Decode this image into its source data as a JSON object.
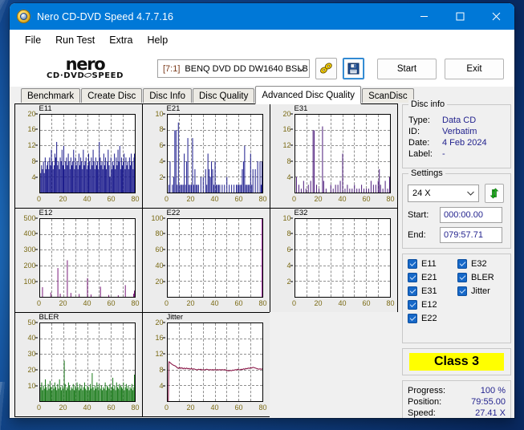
{
  "window": {
    "title": "Nero CD-DVD Speed 4.7.7.16",
    "app_icon": "nero-disc-icon",
    "minimize": "minimize-icon",
    "maximize": "maximize-icon",
    "close": "close-icon"
  },
  "menu": [
    "File",
    "Run Test",
    "Extra",
    "Help"
  ],
  "logo": {
    "word": "nero",
    "sub_left": "CD·DVD",
    "sub_right": "SPEED"
  },
  "toolbar": {
    "drive_index": "[7:1]",
    "drive_name": "BENQ DVD DD DW1640 BSLB",
    "caret": "▼",
    "eject_icon": "disc-speed-icon",
    "save_icon": "floppy-save-icon",
    "start_label": "Start",
    "exit_label": "Exit"
  },
  "tabs": [
    {
      "label": "Benchmark",
      "active": false
    },
    {
      "label": "Create Disc",
      "active": false
    },
    {
      "label": "Disc Info",
      "active": false
    },
    {
      "label": "Disc Quality",
      "active": false
    },
    {
      "label": "Advanced Disc Quality",
      "active": true
    },
    {
      "label": "ScanDisc",
      "active": false
    }
  ],
  "disc_info": {
    "title": "Disc info",
    "rows": [
      {
        "key": "Type:",
        "value": "Data CD"
      },
      {
        "key": "ID:",
        "value": "Verbatim"
      },
      {
        "key": "Date:",
        "value": "4 Feb 2024"
      },
      {
        "key": "Label:",
        "value": "-"
      }
    ]
  },
  "settings": {
    "title": "Settings",
    "speed": "24 X",
    "caret": "▼",
    "refresh_icon": "refresh-green-arrows-icon",
    "start_label": "Start:",
    "start_value": "000:00.00",
    "end_label": "End:",
    "end_value": "079:57.71"
  },
  "checkboxes": [
    {
      "label": "E11",
      "checked": true
    },
    {
      "label": "E32",
      "checked": true
    },
    {
      "label": "E21",
      "checked": true
    },
    {
      "label": "BLER",
      "checked": true
    },
    {
      "label": "E31",
      "checked": true
    },
    {
      "label": "Jitter",
      "checked": true
    },
    {
      "label": "E12",
      "checked": true
    },
    {
      "label": "",
      "checked": false
    },
    {
      "label": "E22",
      "checked": true
    },
    {
      "label": "",
      "checked": false
    }
  ],
  "quality": {
    "class_label": "Class 3",
    "highlight_color": "#ffff00"
  },
  "status": {
    "rows": [
      {
        "key": "Progress:",
        "value": "100 %"
      },
      {
        "key": "Position:",
        "value": "79:55.00"
      },
      {
        "key": "Speed:",
        "value": "27.41 X"
      }
    ]
  },
  "chart_data": [
    {
      "type": "bar",
      "title": "E11",
      "xlabel": "",
      "ylabel": "",
      "xlim": [
        0,
        80
      ],
      "ylim": [
        0,
        20
      ],
      "xticks": [
        0,
        20,
        40,
        60,
        80
      ],
      "yticks": [
        4,
        8,
        12,
        16,
        20
      ],
      "grid": true,
      "color": "#1a1a8c",
      "x": [
        0.5,
        1.2,
        2,
        2.8,
        3.5,
        4.3,
        5,
        5.8,
        6.5,
        7.3,
        8,
        8.8,
        9.5,
        10.3,
        11,
        11.8,
        12.5,
        13.3,
        14,
        14.8,
        15.5,
        16.3,
        17,
        17.8,
        18.5,
        19.3,
        20,
        20.8,
        21.5,
        22.3,
        23,
        23.8,
        24.5,
        25.3,
        26,
        26.8,
        27.5,
        28.3,
        29,
        29.8,
        30.5,
        31.3,
        32,
        32.8,
        33.5,
        34.3,
        35,
        35.8,
        36.5,
        37.3,
        38,
        38.8,
        39.5,
        40.3,
        41,
        41.8,
        42.5,
        43.3,
        44,
        44.8,
        45.5,
        46.3,
        47,
        47.8,
        48.5,
        49.3,
        50,
        50.8,
        51.5,
        52.3,
        53,
        53.8,
        54.5,
        55.3,
        56,
        56.8,
        57.5,
        58.3,
        59,
        59.8,
        60.5,
        61.3,
        62,
        62.8,
        63.5,
        64.3,
        65,
        65.8,
        66.5,
        67.3,
        68,
        68.8,
        69.5,
        70.3,
        71,
        71.8,
        72.5,
        73.3,
        74,
        74.8,
        75.5,
        76.3,
        77,
        77.8,
        78.5,
        79.3,
        80
      ],
      "values": [
        5,
        7,
        6,
        8,
        5,
        9,
        6,
        7,
        8,
        6,
        9,
        7,
        11,
        8,
        6,
        7,
        10,
        9,
        13,
        7,
        8,
        6,
        9,
        8,
        11,
        7,
        12,
        6,
        8,
        9,
        7,
        10,
        8,
        6,
        9,
        7,
        8,
        11,
        6,
        9,
        7,
        8,
        6,
        10,
        7,
        9,
        8,
        6,
        11,
        7,
        8,
        9,
        6,
        7,
        10,
        8,
        6,
        9,
        7,
        11,
        8,
        6,
        9,
        7,
        8,
        6,
        13,
        9,
        7,
        8,
        6,
        10,
        7,
        9,
        6,
        8,
        11,
        7,
        4,
        9,
        6,
        8,
        7,
        10,
        6,
        9,
        7,
        11,
        8,
        12,
        6,
        9,
        7,
        8,
        10,
        6,
        9,
        7,
        8,
        6,
        9,
        7,
        10,
        8,
        6,
        9,
        10
      ]
    },
    {
      "type": "bar",
      "title": "E21",
      "xlabel": "",
      "ylabel": "",
      "xlim": [
        0,
        80
      ],
      "ylim": [
        0,
        10
      ],
      "xticks": [
        0,
        20,
        40,
        60,
        80
      ],
      "yticks": [
        2,
        4,
        6,
        8,
        10
      ],
      "grid": true,
      "color": "#1a1a8c",
      "x": [
        1,
        2,
        4,
        5,
        6,
        7,
        8,
        9,
        10,
        11,
        12,
        13,
        14,
        15,
        16,
        17,
        18,
        19,
        20,
        21,
        22,
        23,
        24,
        25,
        26,
        28,
        30,
        32,
        33,
        34,
        35,
        36,
        37,
        38,
        39,
        40,
        41,
        42,
        43,
        44,
        46,
        48,
        50,
        52,
        54,
        56,
        58,
        59,
        60,
        61,
        62,
        63,
        64,
        65,
        66,
        67,
        68,
        69,
        70,
        71,
        72,
        74,
        76,
        78,
        79,
        80
      ],
      "values": [
        1,
        4,
        1,
        2,
        8,
        8,
        1,
        9,
        1,
        1,
        1,
        1,
        5,
        1,
        4,
        7,
        1,
        1,
        1,
        7,
        1,
        3,
        1,
        1,
        1,
        2,
        2,
        3,
        1,
        5,
        3,
        2,
        4,
        3,
        1,
        4,
        1,
        1,
        1,
        1,
        1,
        1,
        2,
        1,
        1,
        1,
        1,
        1,
        1,
        1,
        1,
        3,
        4,
        6,
        1,
        1,
        1,
        1,
        5,
        1,
        3,
        3,
        4,
        4,
        1,
        4
      ]
    },
    {
      "type": "bar",
      "title": "E31",
      "xlabel": "",
      "ylabel": "",
      "xlim": [
        0,
        80
      ],
      "ylim": [
        0,
        20
      ],
      "xticks": [
        0,
        20,
        40,
        60,
        80
      ],
      "yticks": [
        4,
        8,
        12,
        16,
        20
      ],
      "grid": true,
      "color": "#4b1a7a",
      "x": [
        1,
        3,
        5,
        7,
        9,
        11,
        13,
        15,
        16,
        18,
        20,
        23,
        24,
        26,
        30,
        32,
        34,
        36,
        38,
        40,
        42,
        44,
        46,
        48,
        50,
        52,
        54,
        56,
        58,
        60,
        62,
        64,
        66,
        68,
        70,
        71,
        72,
        74,
        76,
        78,
        80
      ],
      "values": [
        4,
        2,
        1,
        3,
        1,
        2,
        3,
        16,
        16,
        2,
        1,
        17,
        3,
        1,
        2,
        1,
        2,
        2,
        3,
        10,
        1,
        2,
        1,
        1,
        2,
        1,
        1,
        2,
        1,
        1,
        1,
        3,
        2,
        2,
        3,
        6,
        2,
        1,
        3,
        1,
        4
      ]
    },
    {
      "type": "bar",
      "title": "E12",
      "xlabel": "",
      "ylabel": "",
      "xlim": [
        0,
        80
      ],
      "ylim": [
        0,
        500
      ],
      "xticks": [
        0,
        20,
        40,
        60,
        80
      ],
      "yticks": [
        100,
        200,
        300,
        400,
        500
      ],
      "grid": true,
      "color": "#7a1a7a",
      "x": [
        2,
        9,
        15,
        17,
        23,
        26,
        33,
        40,
        43,
        51,
        58,
        66,
        72,
        79,
        80
      ],
      "values": [
        62,
        28,
        185,
        20,
        235,
        25,
        18,
        120,
        15,
        65,
        12,
        10,
        75,
        20,
        40
      ]
    },
    {
      "type": "bar",
      "title": "E22",
      "xlabel": "",
      "ylabel": "",
      "xlim": [
        0,
        80
      ],
      "ylim": [
        0,
        100
      ],
      "xticks": [
        0,
        20,
        40,
        60,
        80
      ],
      "yticks": [
        20,
        40,
        60,
        80,
        100
      ],
      "grid": true,
      "color": "#a01aa0",
      "x": [
        80
      ],
      "values": [
        100
      ]
    },
    {
      "type": "bar",
      "title": "E32",
      "xlabel": "",
      "ylabel": "",
      "xlim": [
        0,
        80
      ],
      "ylim": [
        0,
        10
      ],
      "xticks": [
        0,
        20,
        40,
        60,
        80
      ],
      "yticks": [
        2,
        4,
        6,
        8,
        10
      ],
      "grid": true,
      "color": "#1a1a8c",
      "x": [],
      "values": []
    },
    {
      "type": "bar",
      "title": "BLER",
      "xlabel": "",
      "ylabel": "",
      "xlim": [
        0,
        80
      ],
      "ylim": [
        0,
        50
      ],
      "xticks": [
        0,
        20,
        40,
        60,
        80
      ],
      "yticks": [
        10,
        20,
        30,
        40,
        50
      ],
      "grid": true,
      "color": "#1a7a1a",
      "x": [
        0.5,
        1.3,
        2,
        2.8,
        3.6,
        4.4,
        5.2,
        6,
        6.8,
        7.6,
        8.4,
        9.2,
        10,
        10.8,
        11.6,
        12.4,
        13.2,
        14,
        14.8,
        15.6,
        16.4,
        17.2,
        18,
        18.8,
        19.6,
        20.4,
        21.2,
        22,
        22.8,
        23.6,
        24,
        24.8,
        25.6,
        26.4,
        27.2,
        28,
        28.8,
        29.6,
        30.4,
        31.2,
        32,
        32.8,
        33.6,
        34.4,
        35.2,
        36,
        36.8,
        37.6,
        38.4,
        39.2,
        40,
        40.8,
        41.6,
        42.4,
        43.2,
        44,
        44.8,
        45.6,
        46.4,
        47.2,
        48,
        48.8,
        49.6,
        50,
        51,
        51.8,
        52.6,
        53.4,
        54.2,
        55,
        55.8,
        56.6,
        57.4,
        58.2,
        59,
        59.8,
        60.6,
        61.4,
        62.2,
        63,
        63.8,
        64.6,
        65.4,
        66.2,
        67,
        67.8,
        68,
        68.8,
        69.6,
        70.4,
        71.2,
        72,
        72.8,
        73.6,
        74.4,
        75.2,
        76,
        76.8,
        77.6,
        78.4,
        79.2,
        80
      ],
      "values": [
        9,
        12,
        7,
        10,
        8,
        14,
        9,
        7,
        11,
        8,
        13,
        9,
        7,
        10,
        8,
        12,
        9,
        7,
        11,
        8,
        14,
        9,
        7,
        10,
        8,
        26,
        11,
        7,
        9,
        8,
        12,
        10,
        7,
        9,
        8,
        11,
        7,
        10,
        8,
        12,
        9,
        7,
        11,
        8,
        10,
        7,
        9,
        12,
        8,
        7,
        10,
        9,
        7,
        11,
        8,
        18,
        9,
        7,
        10,
        8,
        12,
        9,
        7,
        11,
        8,
        10,
        7,
        9,
        8,
        12,
        7,
        10,
        9,
        8,
        11,
        7,
        9,
        15,
        8,
        10,
        7,
        12,
        9,
        8,
        11,
        7,
        10,
        9,
        8,
        12,
        7,
        9,
        11,
        8,
        10,
        7,
        9,
        8,
        11,
        7,
        9,
        17
      ]
    },
    {
      "type": "line",
      "title": "Jitter",
      "xlabel": "",
      "ylabel": "",
      "xlim": [
        0,
        80
      ],
      "ylim": [
        0,
        20
      ],
      "xticks": [
        0,
        20,
        40,
        60,
        80
      ],
      "yticks": [
        4,
        8,
        12,
        16,
        20
      ],
      "grid": true,
      "color": "#8c1a4a",
      "x": [
        0.5,
        1,
        2,
        3,
        4,
        5,
        6,
        7,
        8,
        9,
        10,
        11,
        12,
        13,
        14,
        15,
        16,
        17,
        18,
        19,
        20,
        21,
        22,
        23,
        24,
        25,
        26,
        27,
        28,
        29,
        30,
        31,
        32,
        33,
        34,
        35,
        36,
        37,
        38,
        39,
        40,
        41,
        42,
        43,
        44,
        45,
        46,
        47,
        48,
        49,
        50,
        51,
        52,
        53,
        54,
        55,
        56,
        57,
        58,
        59,
        60,
        61,
        62,
        63,
        64,
        65,
        66,
        67,
        68,
        69,
        70,
        71,
        72,
        73,
        74,
        75,
        76,
        77,
        78,
        79,
        80
      ],
      "values": [
        0,
        10.1,
        9.9,
        9.6,
        9.4,
        9.2,
        9.1,
        8.9,
        8.6,
        8.4,
        8.7,
        8.4,
        8.6,
        8.3,
        8.5,
        8.3,
        8.5,
        8.3,
        8.4,
        8.2,
        8.4,
        8.2,
        8.3,
        8.2,
        8.1,
        8.0,
        8.2,
        8.1,
        8.2,
        8.0,
        8.1,
        8.0,
        8.1,
        8.2,
        8.1,
        8.0,
        8.1,
        8.0,
        8.1,
        8.0,
        8.1,
        8.0,
        8.1,
        8.0,
        8.1,
        8.0,
        8.1,
        8.0,
        8.1,
        8.0,
        7.9,
        7.8,
        7.8,
        7.9,
        7.8,
        8.0,
        7.9,
        8.1,
        8.0,
        8.2,
        8.1,
        8.0,
        8.2,
        8.1,
        8.3,
        8.2,
        8.4,
        8.3,
        8.5,
        8.4,
        8.6,
        8.5,
        8.7,
        8.6,
        8.5,
        8.4,
        8.3,
        8.2,
        8.3,
        8.2,
        8.3
      ]
    }
  ]
}
